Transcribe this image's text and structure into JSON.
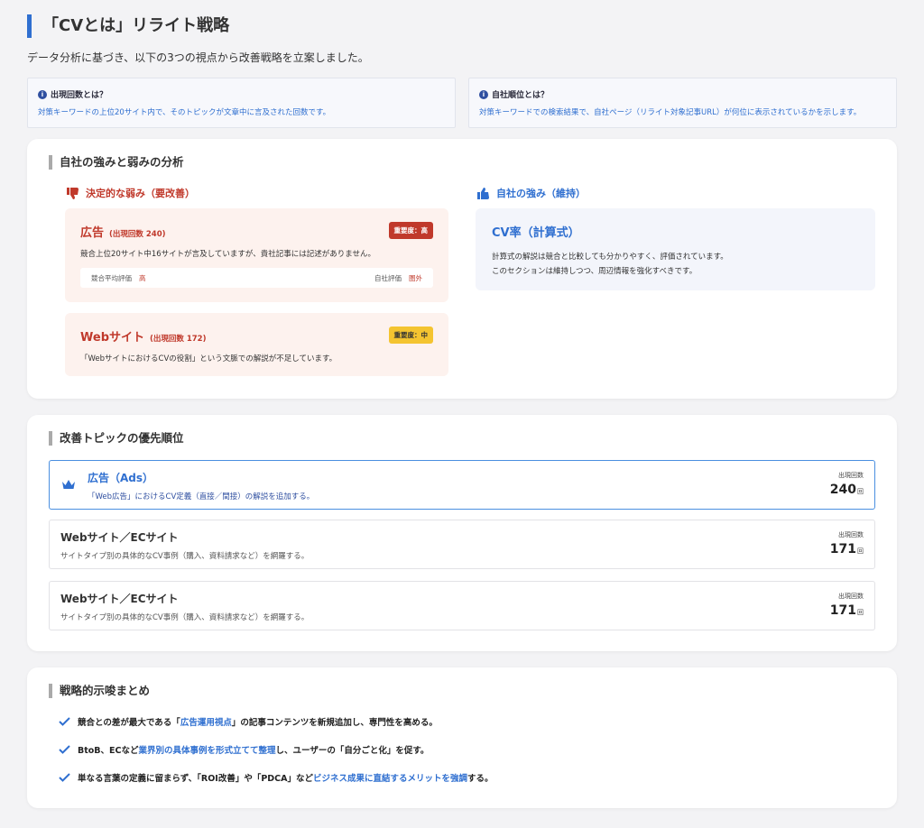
{
  "header": {
    "title": "「CVとは」リライト戦略",
    "subtitle": "データ分析に基づき、以下の3つの視点から改善戦略を立案しました。"
  },
  "info": [
    {
      "title": "出現回数とは？",
      "text": "対策キーワードの上位20サイト内で、そのトピックが文章中に言及された回数です。",
      "icon": "info-icon"
    },
    {
      "title": "自社順位とは？",
      "text": "対策キーワードでの検索結果で、自社ページ（リライト対象記事URL）が何位に表示されているかを示します。",
      "icon": "info-icon"
    }
  ],
  "analysis": {
    "heading": "自社の強みと弱みの分析",
    "weak_heading": "決定的な弱み（要改善）",
    "strong_heading": "自社の強み（維持）",
    "weak_items": [
      {
        "title": "広告",
        "count": "(出現回数 240)",
        "badge": "重要度：高",
        "desc": "競合上位20サイト中16サイトが言及していますが、貴社記事には記述がありません。",
        "eval_left_label": "競合平均評価",
        "eval_left_value": "高",
        "eval_right_label": "自社評価",
        "eval_right_value": "圏外"
      },
      {
        "title": "Webサイト",
        "count": "(出現回数 172)",
        "badge": "重要度：中",
        "desc": "「WebサイトにおけるCVの役割」という文脈での解説が不足しています。"
      }
    ],
    "strong_item": {
      "title": "CV率（計算式）",
      "desc_line1": "計算式の解説は競合と比較しても分かりやすく、評価されています。",
      "desc_line2": "このセクションは維持しつつ、周辺情報を強化すべきです。"
    },
    "colors": {
      "weak": "#c0392b",
      "strong": "#2f6fd0"
    }
  },
  "priority": {
    "heading": "改善トピックの優先順位",
    "count_label": "出現回数",
    "unit": "回",
    "items": [
      {
        "title": "広告（Ads）",
        "desc": "「Web広告」におけるCV定義（直接／間接）の解説を追加する。",
        "count": "240"
      },
      {
        "title": "Webサイト／ECサイト",
        "desc": "サイトタイプ別の具体的なCV事例（購入、資料請求など）を網羅する。",
        "count": "171"
      },
      {
        "title": "Webサイト／ECサイト",
        "desc": "サイトタイプ別の具体的なCV事例（購入、資料請求など）を網羅する。",
        "count": "171"
      }
    ]
  },
  "summary": {
    "heading": "戦略的示唆まとめ",
    "items": [
      {
        "pre": "競合との差が最大である「",
        "hl": "広告運用視点",
        "post": "」の記事コンテンツを新規追加し、専門性を高める。"
      },
      {
        "pre": "BtoB、ECなど",
        "hl": "業界別の具体事例を形式立てて整理",
        "post": "し、ユーザーの「自分ごと化」を促す。"
      },
      {
        "pre": "単なる言葉の定義に留まらず、「ROI改善」や「PDCA」など",
        "hl": "ビジネス成果に直結するメリットを強調",
        "post": "する。"
      }
    ]
  }
}
